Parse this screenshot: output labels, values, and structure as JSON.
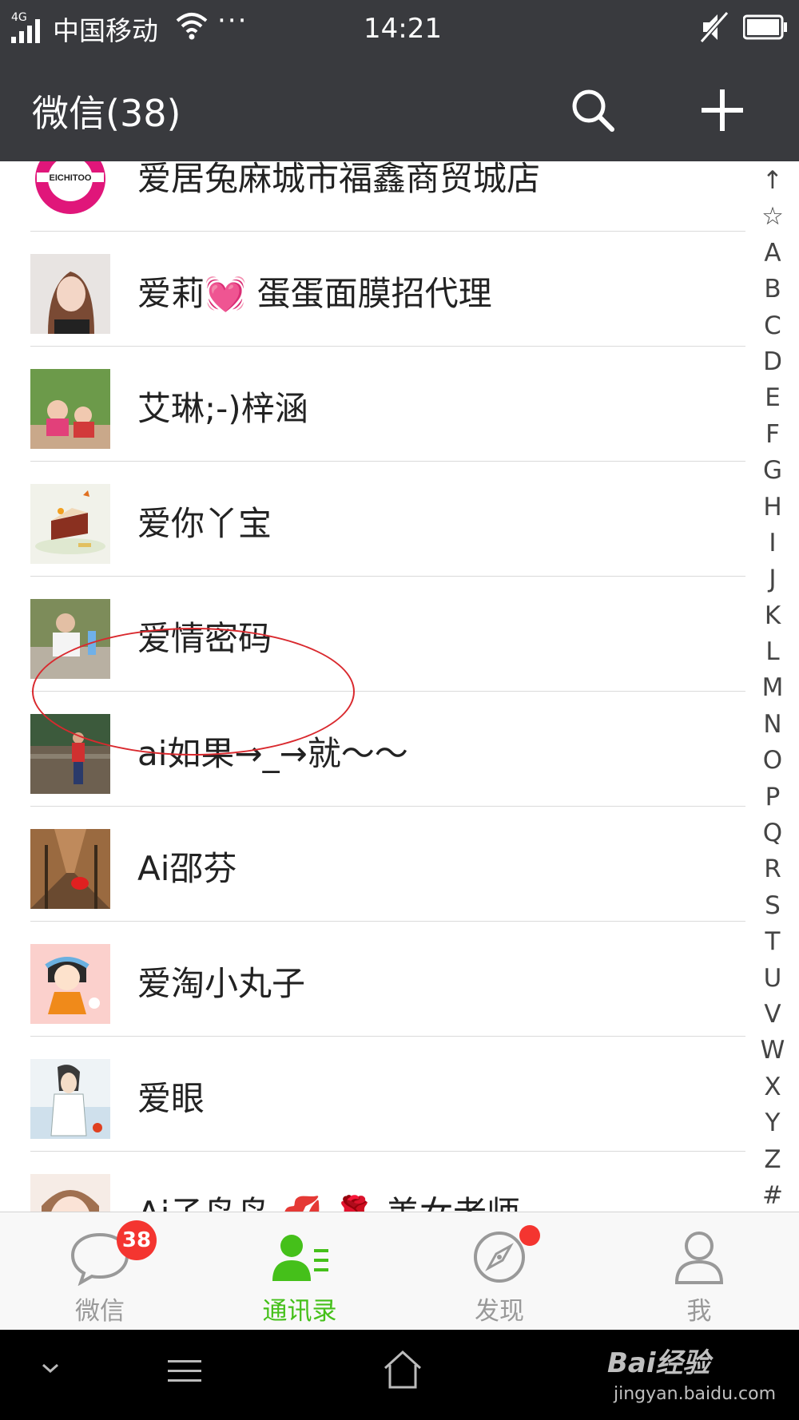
{
  "status_bar": {
    "network_type": "4G",
    "carrier": "中国移动",
    "more": "···",
    "time": "14:21"
  },
  "header": {
    "title": "微信(38)",
    "search_icon": "search-icon",
    "add_icon": "plus-icon"
  },
  "contacts": [
    {
      "name": "爱居兔麻城市福鑫商贸城店",
      "avatar": "brand-logo-avatar"
    },
    {
      "name": "爱莉💓 蛋蛋面膜招代理",
      "avatar": "photo-avatar"
    },
    {
      "name": "艾琳;-)梓涵",
      "avatar": "photo-avatar"
    },
    {
      "name": "爱你丫宝",
      "avatar": "cake-photo-avatar",
      "highlighted": true
    },
    {
      "name": "爱情密码",
      "avatar": "photo-avatar"
    },
    {
      "name": "ai如果→_→就～～",
      "avatar": "photo-avatar"
    },
    {
      "name": "Ai邵芬",
      "avatar": "photo-avatar"
    },
    {
      "name": "爱淘小丸子",
      "avatar": "cartoon-avatar"
    },
    {
      "name": "爱眼",
      "avatar": "drawing-avatar"
    },
    {
      "name": "Ai子鸟鸟 💋 🌹 美女老师",
      "avatar": "photo-avatar"
    }
  ],
  "index_bar": [
    "↑",
    "☆",
    "A",
    "B",
    "C",
    "D",
    "E",
    "F",
    "G",
    "H",
    "I",
    "J",
    "K",
    "L",
    "M",
    "N",
    "O",
    "P",
    "Q",
    "R",
    "S",
    "T",
    "U",
    "V",
    "W",
    "X",
    "Y",
    "Z",
    "#"
  ],
  "tab_bar": {
    "tabs": [
      {
        "label": "微信",
        "icon": "chat-bubble-icon",
        "badge": "38"
      },
      {
        "label": "通讯录",
        "icon": "contacts-icon",
        "active": true
      },
      {
        "label": "发现",
        "icon": "compass-icon",
        "dot": true
      },
      {
        "label": "我",
        "icon": "person-icon"
      }
    ],
    "active_color": "#45c01a",
    "inactive_color": "#999999",
    "badge_color": "#f43530"
  },
  "watermark": {
    "main": "Bai经验",
    "sub": "jingyan.baidu.com"
  },
  "colors": {
    "header_bg": "#393a3e",
    "highlight_circle": "#d9292e"
  }
}
